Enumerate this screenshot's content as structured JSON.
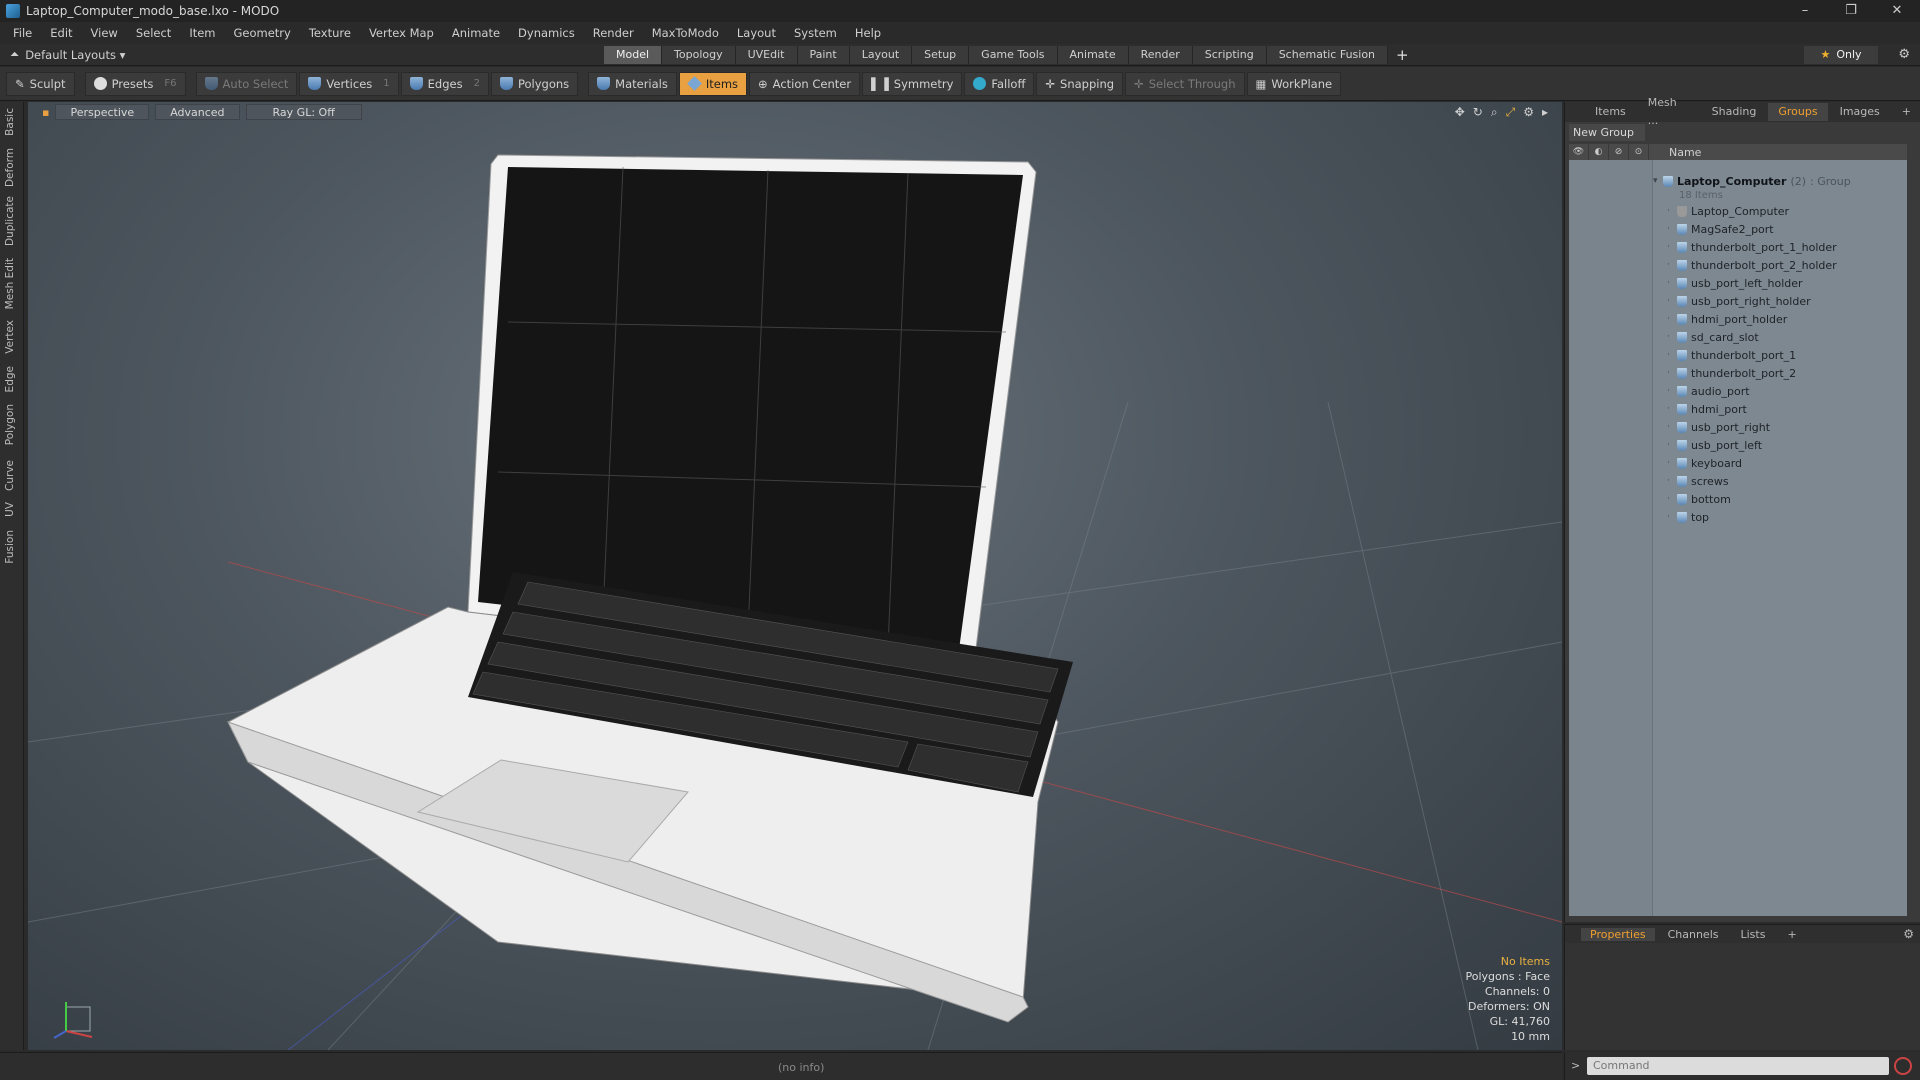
{
  "window": {
    "title": "Laptop_Computer_modo_base.lxo - MODO",
    "controls": [
      "–",
      "❐",
      "✕"
    ]
  },
  "menu": [
    "File",
    "Edit",
    "View",
    "Select",
    "Item",
    "Geometry",
    "Texture",
    "Vertex Map",
    "Animate",
    "Dynamics",
    "Render",
    "MaxToModo",
    "Layout",
    "System",
    "Help"
  ],
  "layouts": {
    "label": "Default Layouts ▾"
  },
  "mode_tabs": [
    {
      "label": "Model",
      "active": true
    },
    {
      "label": "Topology"
    },
    {
      "label": "UVEdit"
    },
    {
      "label": "Paint"
    },
    {
      "label": "Layout"
    },
    {
      "label": "Setup"
    },
    {
      "label": "Game Tools"
    },
    {
      "label": "Animate"
    },
    {
      "label": "Render"
    },
    {
      "label": "Scripting"
    },
    {
      "label": "Schematic Fusion"
    }
  ],
  "only_button": "Only",
  "toolbar": {
    "sculpt": "Sculpt",
    "presets": "Presets",
    "presets_hotkey": "F6",
    "auto_select": "Auto Select",
    "vertices": "Vertices",
    "vertices_hotkey": "1",
    "edges": "Edges",
    "edges_hotkey": "2",
    "polygons": "Polygons",
    "materials": "Materials",
    "items": "Items",
    "action_center": "Action Center",
    "symmetry": "Symmetry",
    "falloff": "Falloff",
    "snapping": "Snapping",
    "select_through": "Select Through",
    "workplane": "WorkPlane"
  },
  "left_tabs": [
    "Basic",
    "Deform",
    "Duplicate",
    "Mesh Edit",
    "Vertex",
    "Edge",
    "Polygon",
    "Curve",
    "UV",
    "Fusion"
  ],
  "viewport": {
    "view_mode": "Perspective",
    "shading": "Advanced",
    "raygl": "Ray GL: Off",
    "info": {
      "selection": "No Items",
      "polygons": "Polygons : Face",
      "channels": "Channels: 0",
      "deformers": "Deformers: ON",
      "gl": "GL: 41,760",
      "unit": "10 mm"
    }
  },
  "status": {
    "text": "(no info)"
  },
  "right_panel": {
    "tabs": [
      {
        "label": "Items"
      },
      {
        "label": "Mesh ..."
      },
      {
        "label": "Shading"
      },
      {
        "label": "Groups",
        "active": true
      },
      {
        "label": "Images"
      }
    ],
    "new_group": "New Group",
    "column_name": "Name",
    "group": {
      "name": "Laptop_Computer",
      "count": "(2)",
      "type": ": Group",
      "items": "18 Items"
    },
    "items": [
      "Laptop_Computer",
      "MagSafe2_port",
      "thunderbolt_port_1_holder",
      "thunderbolt_port_2_holder",
      "usb_port_left_holder",
      "usb_port_right_holder",
      "hdmi_port_holder",
      "sd_card_slot",
      "thunderbolt_port_1",
      "thunderbolt_port_2",
      "audio_port",
      "hdmi_port",
      "usb_port_right",
      "usb_port_left",
      "keyboard",
      "screws",
      "bottom",
      "top"
    ]
  },
  "properties_tabs": [
    {
      "label": "Properties",
      "active": true
    },
    {
      "label": "Channels"
    },
    {
      "label": "Lists"
    }
  ],
  "command": {
    "placeholder": "Command"
  }
}
